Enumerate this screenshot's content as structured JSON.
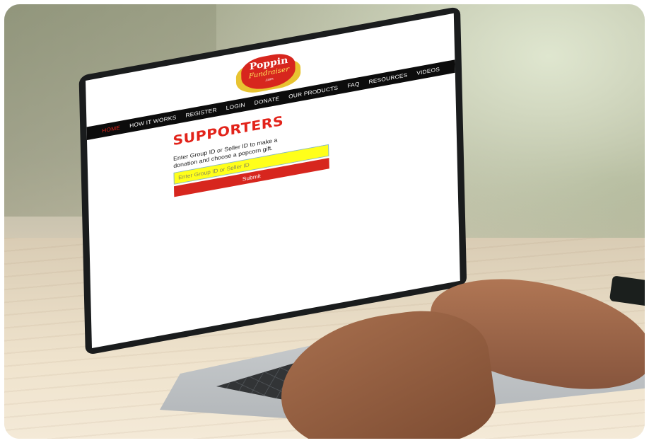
{
  "site": {
    "logo": {
      "line1": "Poppin",
      "line2": "Fundraiser",
      "line3": ".com"
    },
    "nav": {
      "items": [
        {
          "label": "HOME",
          "active": true
        },
        {
          "label": "HOW IT WORKS",
          "active": false
        },
        {
          "label": "REGISTER",
          "active": false
        },
        {
          "label": "LOGIN",
          "active": false
        },
        {
          "label": "DONATE",
          "active": false
        },
        {
          "label": "OUR PRODUCTS",
          "active": false
        },
        {
          "label": "FAQ",
          "active": false
        },
        {
          "label": "RESOURCES",
          "active": false
        },
        {
          "label": "VIDEOS",
          "active": false
        }
      ]
    },
    "page": {
      "title": "SUPPORTERS",
      "help_text": "Enter Group ID or Seller ID to make a donation and choose a popcorn gift.",
      "input": {
        "placeholder": "Enter Group ID or Seller ID",
        "value": ""
      },
      "submit_label": "Submit"
    }
  },
  "colors": {
    "accent_red": "#e2231a",
    "input_yellow": "#ffff1a",
    "nav_bg": "#0c0c0c"
  }
}
